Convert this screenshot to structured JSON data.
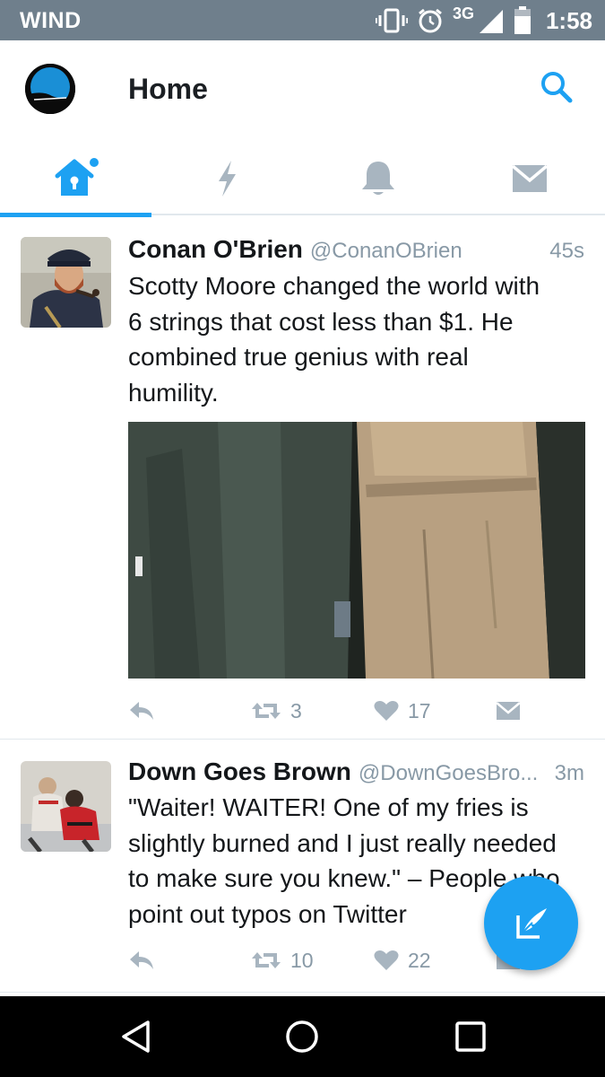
{
  "status_bar": {
    "carrier": "WIND",
    "network": "3G",
    "time": "1:58",
    "icons": [
      "vibrate-icon",
      "alarm-icon",
      "signal-icon",
      "battery-icon"
    ]
  },
  "header": {
    "title": "Home",
    "search_icon": "search-icon",
    "tabs": [
      {
        "name": "home",
        "icon": "home-icon",
        "active": true,
        "has_dot": true
      },
      {
        "name": "moments",
        "icon": "lightning-icon",
        "active": false
      },
      {
        "name": "notifications",
        "icon": "bell-icon",
        "active": false
      },
      {
        "name": "messages",
        "icon": "envelope-icon",
        "active": false
      }
    ]
  },
  "tweets": [
    {
      "name": "Conan O'Brien",
      "handle": "@ConanOBrien",
      "time": "45s",
      "lines": [
        "Scotty Moore changed the world with",
        "6 strings that cost less than $1. He",
        "combined true genius with real",
        "humility."
      ],
      "retweets": "3",
      "likes": "17"
    },
    {
      "name": "Down Goes Brown",
      "handle": "@DownGoesBro...",
      "time": "3m",
      "lines": [
        "\"Waiter! WAITER! One of my fries is",
        "slightly burned and I just really needed",
        "to make sure you knew.\" – People who",
        "point out typos on Twitter"
      ],
      "retweets": "10",
      "likes": "22"
    }
  ],
  "colors": {
    "accent": "#1da1f2",
    "status_bar": "#6f7f8c",
    "secondary_text": "#8899a6",
    "icon_gray": "#a8b5c0"
  },
  "fab_icon": "compose-icon",
  "nav": [
    "back-icon",
    "home-circle-icon",
    "recents-icon"
  ]
}
